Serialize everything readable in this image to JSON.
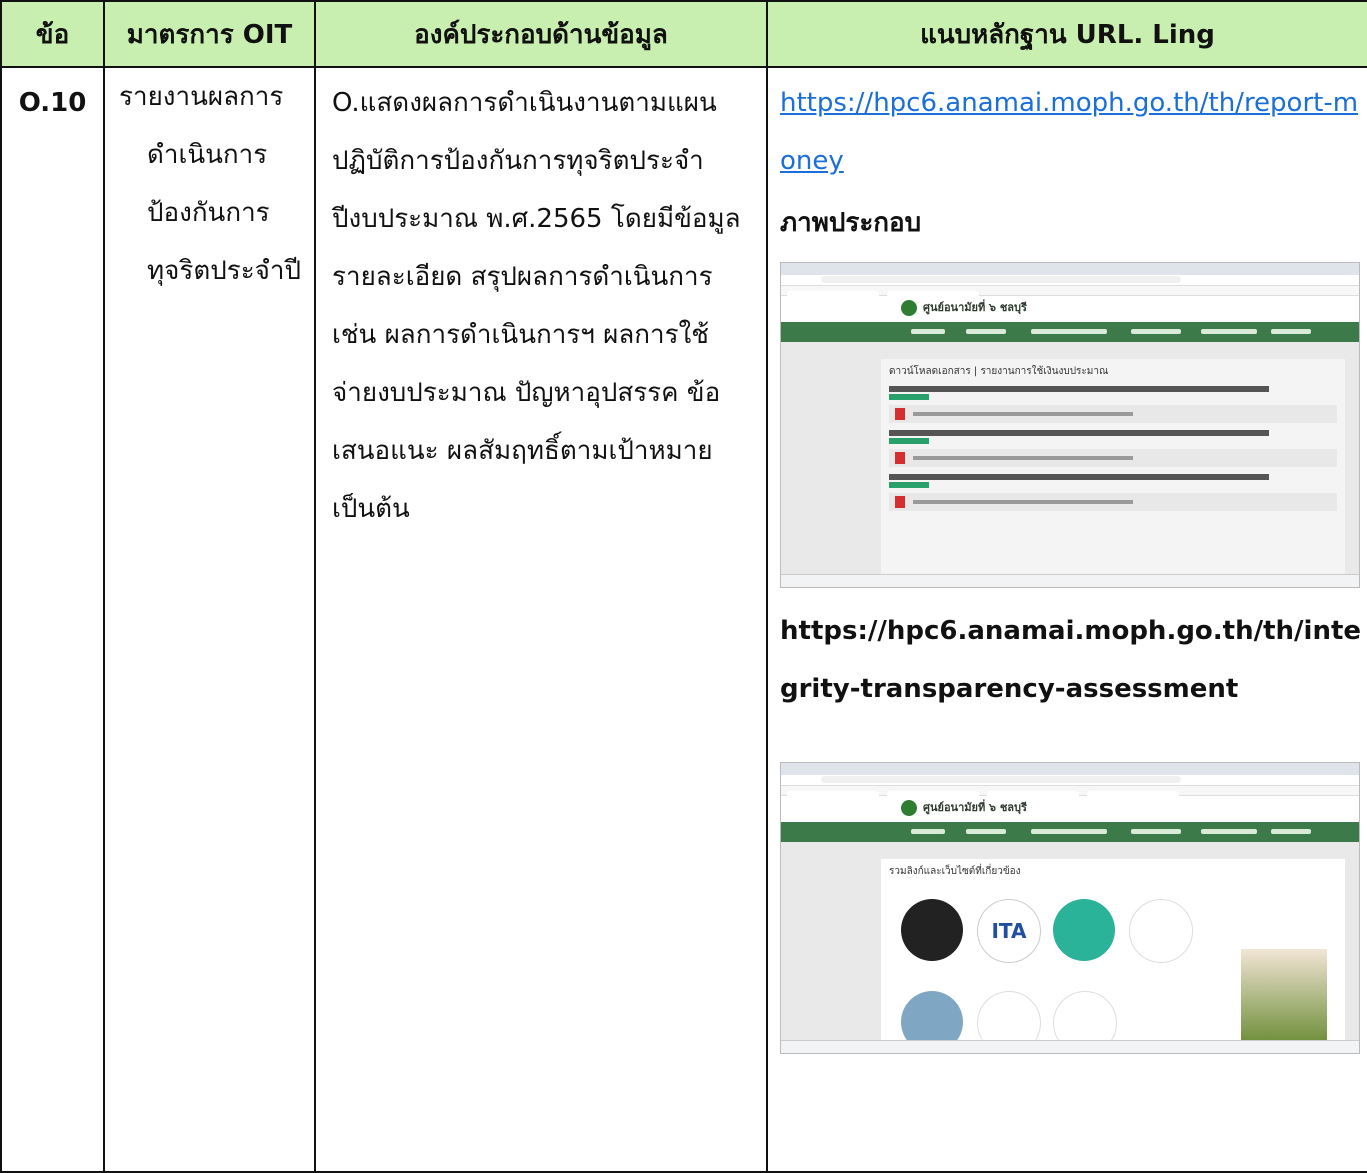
{
  "header": {
    "col_no": "ข้อ",
    "col_measure": "มาตรการ OIT",
    "col_component": "องค์ประกอบด้านข้อมูล",
    "col_evidence": "แนบหลักฐาน URL. Ling"
  },
  "row": {
    "no": "O.10",
    "measure_lines": [
      "รายงานผลการ",
      "ดำเนินการ",
      "ป้องกันการ",
      "ทุจริตประจำปี"
    ],
    "component_text": "O.แสดงผลการดำเนินงานตามแผนปฏิบัติการป้องกันการทุจริตประจำปีงบประมาณ พ.ศ.2565 โดยมีข้อมูลรายละเอียด สรุปผลการดำเนินการ เช่น ผลการดำเนินการฯ ผลการใช้จ่ายงบประมาณ ปัญหาอุปสรรค ข้อเสนอแนะ ผลสัมฤทธิ์ตามเป้าหมาย เป็นต้น",
    "evidence": {
      "link1": "https://hpc6.anamai.moph.go.th/th/report-money",
      "figure_label": "ภาพประกอบ",
      "link2": "https://hpc6.anamai.moph.go.th/th/integrity-transparency-assessment"
    }
  },
  "screenshot1": {
    "site_name": "ศูนย์อนามัยที่ ๖ ชลบุรี",
    "page_title": "ดาวน์โหลดเอกสาร | รายงานการใช้เงินงบประมาณ"
  },
  "screenshot2": {
    "site_name": "ศูนย์อนามัยที่ ๖ ชลบุรี",
    "section_title": "รวมลิงก์และเว็บไซต์ที่เกี่ยวข้อง",
    "logo_text": "ITA"
  }
}
